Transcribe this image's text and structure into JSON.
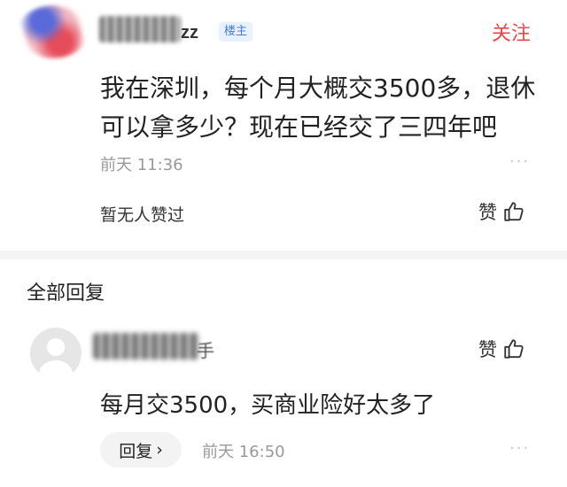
{
  "post": {
    "author_suffix": "zz",
    "author_badge": "楼主",
    "follow_label": "关注",
    "text": "我在深圳，每个月大概交3500多，退休可以拿多少？现在已经交了三四年吧",
    "time": "前天  11:36",
    "more": "···",
    "likes_text": "暂无人赞过",
    "like_label": "赞"
  },
  "replies_section": {
    "title": "全部回复"
  },
  "reply": {
    "author_suffix": "手",
    "like_label": "赞",
    "text": "每月交3500，买商业险好太多了",
    "reply_button": "回复",
    "reply_chevron": "›",
    "time": "前天  16:50",
    "more": "···"
  },
  "icons": {
    "like": "thumbs-up-icon",
    "avatar": "default-avatar-icon"
  },
  "colors": {
    "follow": "#e8474a",
    "badge_text": "#3f7fe0",
    "badge_bg": "#e9f1fe",
    "muted": "#999999"
  }
}
